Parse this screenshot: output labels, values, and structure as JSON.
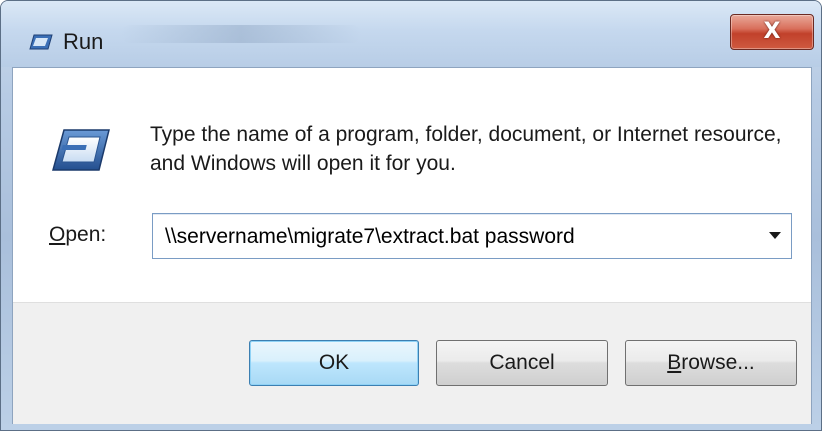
{
  "window": {
    "title": "Run",
    "title_icon": "run-icon",
    "close_glyph": "X"
  },
  "content": {
    "icon": "run-icon",
    "description": "Type the name of a program, folder, document, or Internet resource, and Windows will open it for you."
  },
  "open_field": {
    "label_accel": "O",
    "label_rest": "pen:",
    "value": "\\\\servername\\migrate7\\extract.bat password"
  },
  "buttons": {
    "ok_label": "OK",
    "cancel_label": "Cancel",
    "browse_accel": "B",
    "browse_rest": "rowse..."
  },
  "colors": {
    "close_button": "#c1412b",
    "default_button_border": "#3c7fb1",
    "title_bar": "#c5d8ee"
  }
}
